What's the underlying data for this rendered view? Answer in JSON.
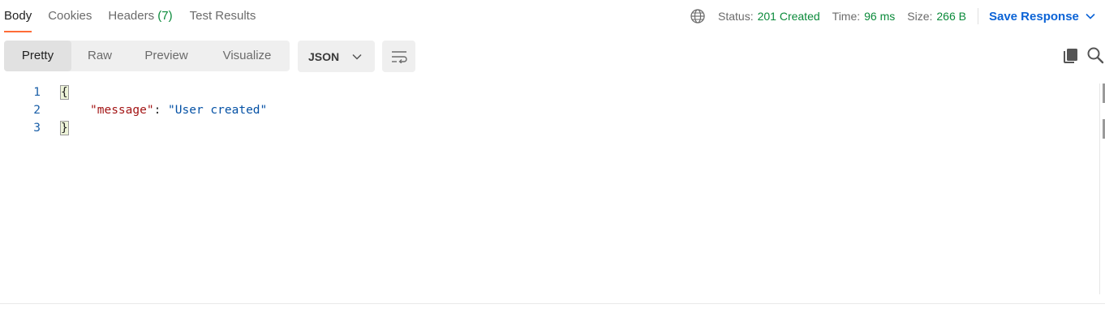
{
  "tabs": [
    {
      "label": "Body",
      "count": ""
    },
    {
      "label": "Cookies",
      "count": ""
    },
    {
      "label": "Headers",
      "count": "(7)"
    },
    {
      "label": "Test Results",
      "count": ""
    }
  ],
  "response_meta": {
    "status_label": "Status:",
    "status_value": "201 Created",
    "time_label": "Time:",
    "time_value": "96 ms",
    "size_label": "Size:",
    "size_value": "266 B"
  },
  "save_response_label": "Save Response",
  "view_modes": [
    "Pretty",
    "Raw",
    "Preview",
    "Visualize"
  ],
  "active_view": "Pretty",
  "format_value": "JSON",
  "code_lines": [
    {
      "number": "1",
      "text": "{"
    },
    {
      "number": "2",
      "key": "\"message\"",
      "sep": ": ",
      "value": "\"User created\""
    },
    {
      "number": "3",
      "text": "}"
    }
  ],
  "colors": {
    "accent_tab": "#ff6c37",
    "status_green": "#0a8a3a",
    "link_blue": "#0b63d6",
    "json_key": "#a31515",
    "json_string": "#0451a5"
  },
  "icons": [
    "globe-icon",
    "chevron-down-icon",
    "wrap-lines-icon",
    "copy-icon",
    "search-icon"
  ]
}
